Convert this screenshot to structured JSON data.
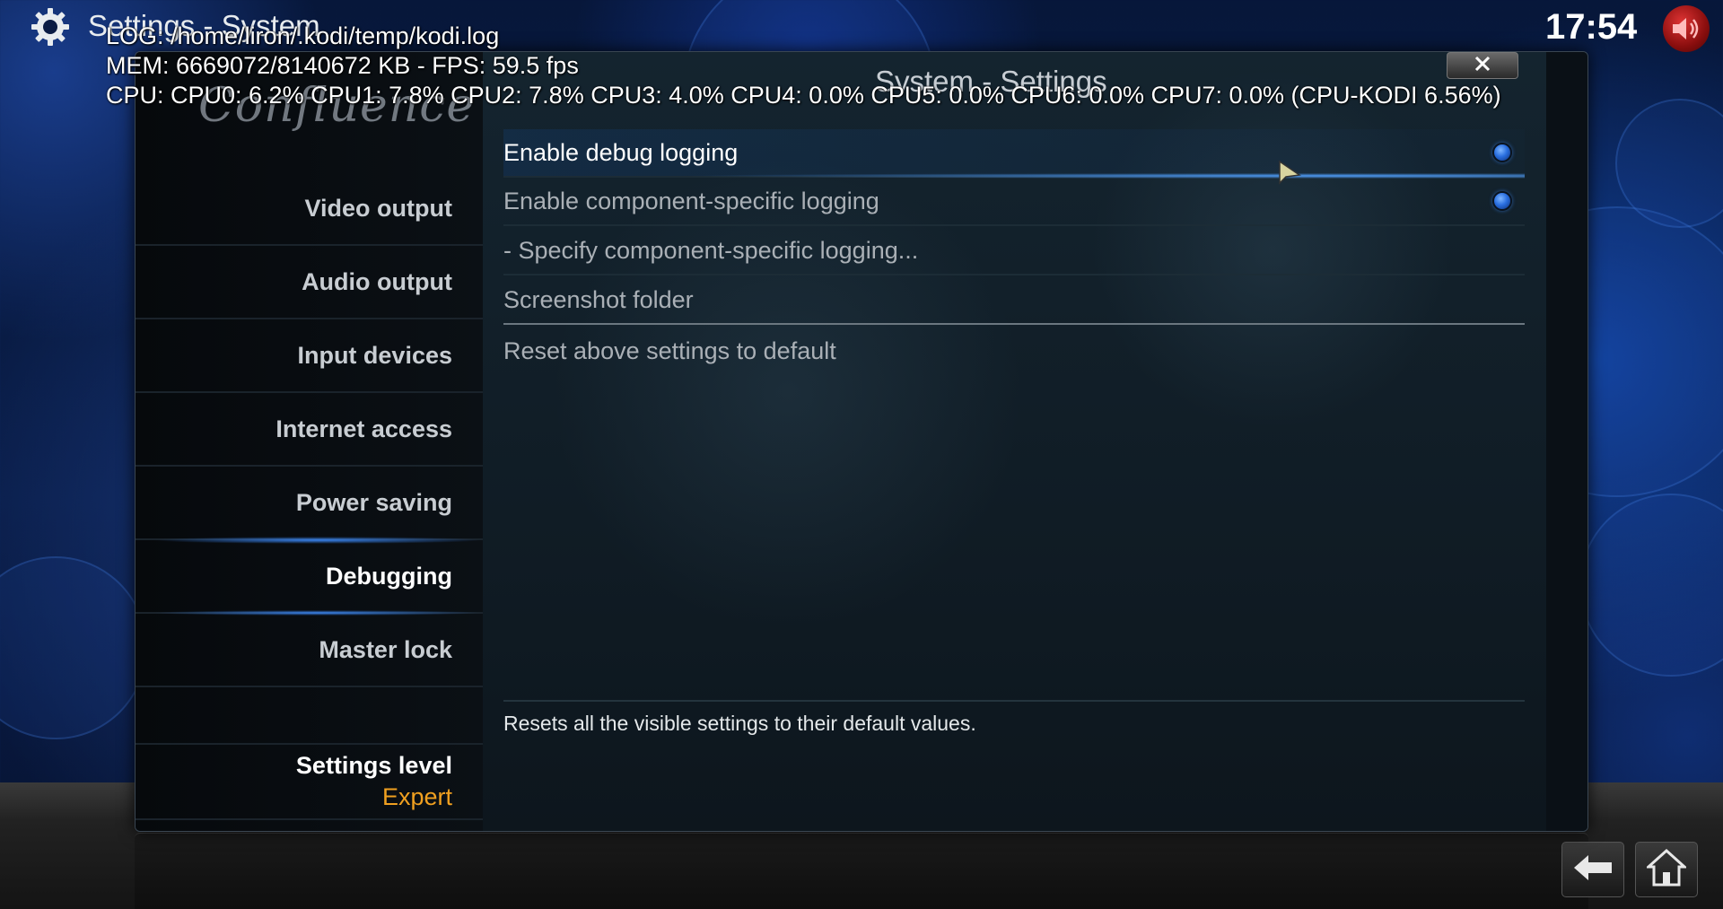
{
  "header": {
    "title": "Settings - System",
    "clock": "17:54",
    "mute_icon": "speaker-muted-icon",
    "settings_icon": "gear-icon"
  },
  "debug_overlay": {
    "log_line": "LOG: /home/liron/.kodi/temp/kodi.log",
    "mem_line": "MEM: 6669072/8140672 KB - FPS: 59.5 fps",
    "cpu_line": "CPU: CPU0: 6.2% CPU1: 7.8% CPU2: 7.8% CPU3: 4.0% CPU4: 0.0% CPU5: 0.0% CPU6: 0.0% CPU7: 0.0% (CPU-KODI 6.56%)"
  },
  "dialog": {
    "title": "System - Settings",
    "logo": "Confluence",
    "close_icon": "close-icon"
  },
  "sidebar": {
    "items": [
      {
        "label": "Video output",
        "active": false
      },
      {
        "label": "Audio output",
        "active": false
      },
      {
        "label": "Input devices",
        "active": false
      },
      {
        "label": "Internet access",
        "active": false
      },
      {
        "label": "Power saving",
        "active": false
      },
      {
        "label": "Debugging",
        "active": true
      },
      {
        "label": "Master lock",
        "active": false
      }
    ],
    "settings_level_label": "Settings level",
    "settings_level_value": "Expert"
  },
  "settings": {
    "rows": [
      {
        "label": "Enable debug logging",
        "has_radio": true,
        "focused": true
      },
      {
        "label": "Enable component-specific logging",
        "has_radio": true,
        "focused": false
      },
      {
        "label": "- Specify component-specific logging...",
        "has_radio": false,
        "focused": false
      },
      {
        "label": "Screenshot folder",
        "has_radio": false,
        "focused": false
      },
      {
        "label": "Reset above settings to default",
        "has_radio": false,
        "focused": false
      }
    ],
    "description": "Resets all the visible settings to their default values."
  },
  "footer": {
    "back_icon": "back-arrow-icon",
    "home_icon": "home-icon"
  },
  "colors": {
    "accent_blue": "#3c8cff",
    "level_orange": "#f0a020"
  }
}
